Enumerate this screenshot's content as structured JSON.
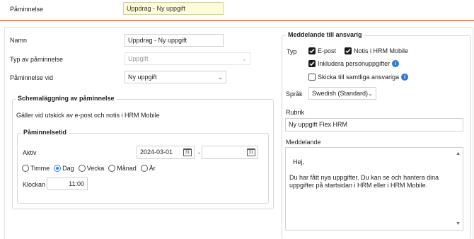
{
  "header": {
    "reminder_label": "Påminnelse",
    "reminder_value": "Uppdrag - Ny uppgift"
  },
  "form": {
    "name_label": "Namn",
    "name_value": "Uppdrag - Ny uppgift",
    "type_label": "Typ av påminnelse",
    "type_value": "Uppgift",
    "trigger_label": "Påminnelse vid",
    "trigger_value": "Ny uppgift"
  },
  "schedule": {
    "legend": "Schemaläggning av påminnelse",
    "description": "Gäller vid utskick av e-post och notis i HRM Mobile",
    "period": {
      "legend": "Påminnelsetid",
      "active_label": "Aktiv",
      "date_from": "2024-03-01",
      "date_separator": "-",
      "date_to": "",
      "calendar_glyph": "31",
      "radios": [
        {
          "label": "Timme",
          "selected": false
        },
        {
          "label": "Dag",
          "selected": true
        },
        {
          "label": "Vecka",
          "selected": false
        },
        {
          "label": "Månad",
          "selected": false
        },
        {
          "label": "År",
          "selected": false
        }
      ],
      "time_label": "Klockan",
      "time_value": "11:00"
    }
  },
  "message": {
    "legend": "Meddelande till ansvarig",
    "type_label": "Typ",
    "email_label": "E-post",
    "email_checked": true,
    "notify_label": "Notis i HRM Mobile",
    "notify_checked": true,
    "include_person_label": "Inkludera personuppgifter",
    "include_person_checked": true,
    "send_all_label": "Skicka till samtliga ansvariga",
    "send_all_checked": false,
    "language_label": "Språk",
    "language_value": "Swedish (Standard)",
    "subject_label": "Rubrik",
    "subject_value": "Ny uppgift Flex HRM",
    "body_label": "Meddelande",
    "body_value": "Hej,\n\nDu har fått nya uppgifter. Du kan se och hantera dina uppgifter på startsidan i HRM eller i HRM Mobile."
  },
  "colors": {
    "accent_divider": "#e98a76",
    "checkbox": "#1a1a1a",
    "radio_selected": "#3b7bd6",
    "info_icon": "#2f78d0",
    "highlight_input": "#fefbd9"
  }
}
